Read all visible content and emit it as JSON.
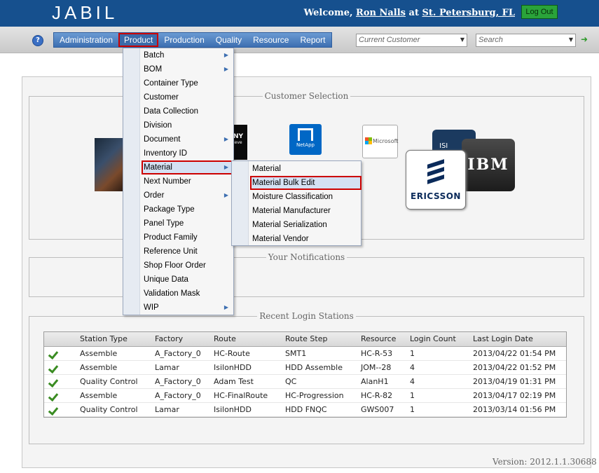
{
  "header": {
    "logo": "JABIL",
    "welcome_prefix": "Welcome,",
    "user": "Ron Nalls",
    "at": "at",
    "site": "St. Petersburg, FL",
    "logout": "Log Out"
  },
  "nav": {
    "help": "?",
    "items": [
      "Administration",
      "Product",
      "Production",
      "Quality",
      "Resource",
      "Report"
    ],
    "active": "Product",
    "customer_placeholder": "Current Customer",
    "search_placeholder": "Search",
    "go": "➜"
  },
  "product_menu": [
    {
      "label": "Batch",
      "submenu": true
    },
    {
      "label": "BOM",
      "submenu": true
    },
    {
      "label": "Container Type",
      "submenu": false
    },
    {
      "label": "Customer",
      "submenu": false
    },
    {
      "label": "Data Collection",
      "submenu": false
    },
    {
      "label": "Division",
      "submenu": false
    },
    {
      "label": "Document",
      "submenu": true
    },
    {
      "label": "Inventory ID",
      "submenu": false
    },
    {
      "label": "Material",
      "submenu": true
    },
    {
      "label": "Next Number",
      "submenu": false
    },
    {
      "label": "Order",
      "submenu": true
    },
    {
      "label": "Package Type",
      "submenu": false
    },
    {
      "label": "Panel Type",
      "submenu": false
    },
    {
      "label": "Product Family",
      "submenu": false
    },
    {
      "label": "Reference Unit",
      "submenu": false
    },
    {
      "label": "Shop Floor Order",
      "submenu": false
    },
    {
      "label": "Unique Data",
      "submenu": false
    },
    {
      "label": "Validation Mask",
      "submenu": false
    },
    {
      "label": "WIP",
      "submenu": true
    }
  ],
  "material_menu": [
    "Material",
    "Material Bulk Edit",
    "Moisture Classification",
    "Material Manufacturer",
    "Material Serialization",
    "Material Vendor"
  ],
  "sections": {
    "customer_selection": "Customer Selection",
    "notifications": "Your Notifications",
    "recent_logins": "Recent Login Stations"
  },
  "logos": {
    "sony": "NY",
    "sony_sub": "ieve",
    "netapp": "NetApp",
    "microsoft": "Microsoft",
    "isilon": "ISI",
    "ibm": "IBM",
    "ericsson": "ERICSSON"
  },
  "table": {
    "columns": [
      "Station Type",
      "Factory",
      "Route",
      "Route Step",
      "Resource",
      "Login Count",
      "Last Login Date"
    ],
    "rows": [
      [
        "Assemble",
        "A_Factory_0",
        "HC-Route",
        "SMT1",
        "HC-R-53",
        "1",
        "2013/04/22 01:54 PM"
      ],
      [
        "Assemble",
        "Lamar",
        "IsilonHDD",
        "HDD Assemble",
        "JOM--28",
        "4",
        "2013/04/22 01:52 PM"
      ],
      [
        "Quality Control",
        "A_Factory_0",
        "Adam Test",
        "QC",
        "AlanH1",
        "4",
        "2013/04/19 01:31 PM"
      ],
      [
        "Assemble",
        "A_Factory_0",
        "HC-FinalRoute",
        "HC-Progression",
        "HC-R-82",
        "1",
        "2013/04/17 02:19 PM"
      ],
      [
        "Quality Control",
        "Lamar",
        "IsilonHDD",
        "HDD FNQC",
        "GWS007",
        "1",
        "2013/03/14 01:56 PM"
      ]
    ]
  },
  "version": "Version: 2012.1.1.30688",
  "colors": {
    "header_bg": "#16508e",
    "menu_bg": "#3d6fb1",
    "highlight_border": "#cc0000",
    "logout_bg": "#2aa33a",
    "check_green": "#3a8c22"
  }
}
